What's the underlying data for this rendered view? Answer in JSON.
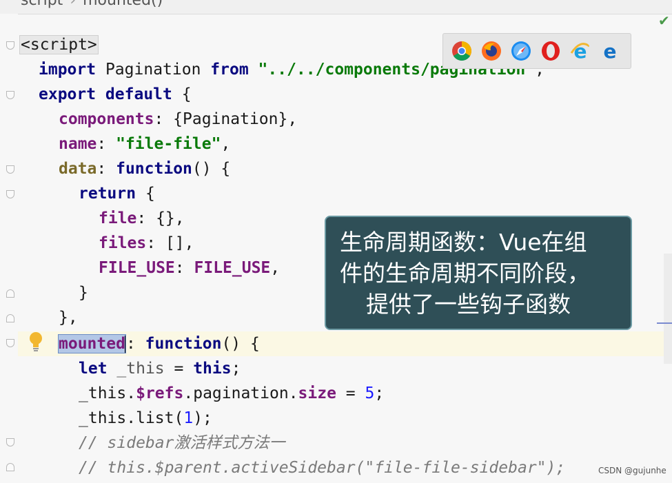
{
  "breadcrumb": {
    "part1": "script",
    "part2": "mounted()"
  },
  "code_lines": [
    "<script>",
    "import Pagination from \"../../components/pagination\";",
    "export default {",
    "components: {Pagination},",
    "name: \"file-file\",",
    "data: function() {",
    "return {",
    "file: {},",
    "files: [],",
    "FILE_USE: FILE_USE,",
    "}",
    "},",
    "mounted: function() {",
    "let _this = this;",
    "_this.$refs.pagination.size = 5;",
    "_this.list(1);",
    "// sidebar激活样式方法一",
    "// this.$parent.activeSidebar(\"file-file-sidebar\");"
  ],
  "tokens": {
    "script_tag": "<script>",
    "import": "import",
    "pagination": "Pagination",
    "from": "from",
    "import_path": "\"../../components/pagination\"",
    "semicolon": ";",
    "export_default": "export default",
    "brace_open": "{",
    "components": "components",
    "components_value": ": {Pagination},",
    "name": "name",
    "colon": ":",
    "name_value": "\"file-file\"",
    "comma": ",",
    "data": "data",
    "function": "function",
    "fn_tail": "() {",
    "return": "return",
    "file": "file",
    "file_value": ": {},",
    "files": "files",
    "files_value": ": [],",
    "file_use": "FILE_USE",
    "brace_close": "}",
    "brace_close_comma": "},",
    "mounted": "mounted",
    "let": "let",
    "this_var": "_this",
    "equals": " = ",
    "this": "this",
    "dot": ".",
    "refs": "$refs",
    "pagination_size": "pagination.",
    "size": "size",
    "five": "5",
    "list_call": ".list(",
    "one": "1",
    "close_paren_semi": ");",
    "comment1": "// sidebar激活样式方法一",
    "comment2": "// this.$parent.activeSidebar(\"file-file-sidebar\");"
  },
  "tooltip": {
    "line1": "生命周期函数：Vue在组",
    "line2": "件的生命周期不同阶段，",
    "line3": "提供了一些钩子函数"
  },
  "browsers": [
    "chrome-icon",
    "firefox-icon",
    "safari-icon",
    "opera-icon",
    "ie-icon",
    "edge-icon"
  ],
  "watermark": "CSDN @gujunhe",
  "colors": {
    "keyword": "#0a0a80",
    "property": "#7a1a7a",
    "string": "#0a7a0a",
    "tooltip_bg": "#2f4f57",
    "selection": "#b3c7e6"
  }
}
